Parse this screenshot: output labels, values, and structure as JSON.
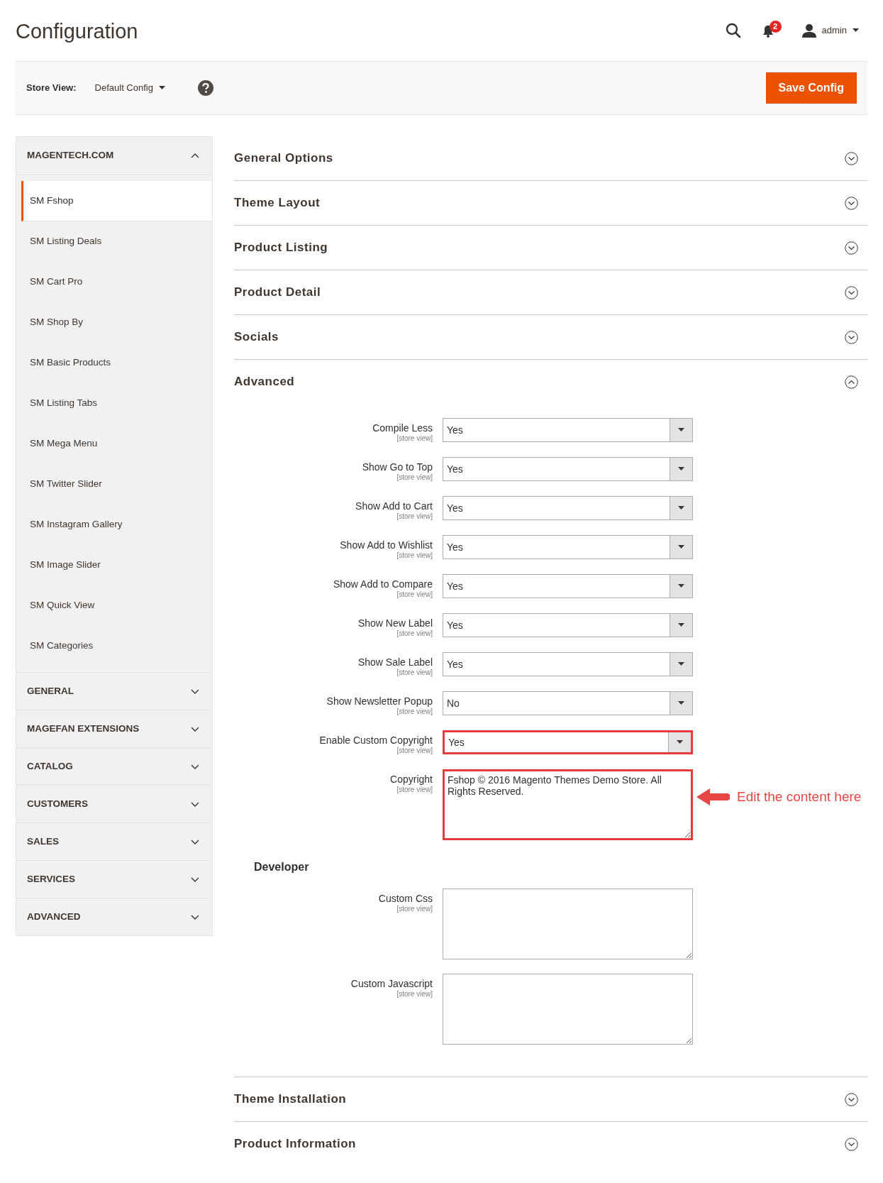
{
  "page_title": "Configuration",
  "header": {
    "notifications_count": "2",
    "user": "admin"
  },
  "store_bar": {
    "label": "Store View:",
    "value": "Default Config",
    "save_button": "Save Config"
  },
  "sidebar": [
    {
      "title": "MAGENTECH.COM",
      "expanded": true,
      "items": [
        {
          "label": "SM Fshop",
          "selected": true
        },
        {
          "label": "SM Listing Deals",
          "selected": false
        },
        {
          "label": "SM Cart Pro",
          "selected": false
        },
        {
          "label": "SM Shop By",
          "selected": false
        },
        {
          "label": "SM Basic Products",
          "selected": false
        },
        {
          "label": "SM Listing Tabs",
          "selected": false
        },
        {
          "label": "SM Mega Menu",
          "selected": false
        },
        {
          "label": "SM Twitter Slider",
          "selected": false
        },
        {
          "label": "SM Instagram Gallery",
          "selected": false
        },
        {
          "label": "SM Image Slider",
          "selected": false
        },
        {
          "label": "SM Quick View",
          "selected": false
        },
        {
          "label": "SM Categories",
          "selected": false
        }
      ]
    },
    {
      "title": "GENERAL",
      "expanded": false
    },
    {
      "title": "MAGEFAN EXTENSIONS",
      "expanded": false
    },
    {
      "title": "CATALOG",
      "expanded": false
    },
    {
      "title": "CUSTOMERS",
      "expanded": false
    },
    {
      "title": "SALES",
      "expanded": false
    },
    {
      "title": "SERVICES",
      "expanded": false
    },
    {
      "title": "ADVANCED",
      "expanded": false
    }
  ],
  "sections": [
    {
      "title": "General Options",
      "expanded": false
    },
    {
      "title": "Theme Layout",
      "expanded": false
    },
    {
      "title": "Product Listing",
      "expanded": false
    },
    {
      "title": "Product Detail",
      "expanded": false
    },
    {
      "title": "Socials",
      "expanded": false
    },
    {
      "title": "Advanced",
      "expanded": true,
      "groups": [
        {
          "fields": [
            {
              "label": "Compile Less",
              "scope": "[store view]",
              "kind": "select",
              "value": "Yes",
              "highlighted": false
            },
            {
              "label": "Show Go to Top",
              "scope": "[store view]",
              "kind": "select",
              "value": "Yes",
              "highlighted": false
            },
            {
              "label": "Show Add to Cart",
              "scope": "[store view]",
              "kind": "select",
              "value": "Yes",
              "highlighted": false
            },
            {
              "label": "Show Add to Wishlist",
              "scope": "[store view]",
              "kind": "select",
              "value": "Yes",
              "highlighted": false
            },
            {
              "label": "Show Add to Compare",
              "scope": "[store view]",
              "kind": "select",
              "value": "Yes",
              "highlighted": false
            },
            {
              "label": "Show New Label",
              "scope": "[store view]",
              "kind": "select",
              "value": "Yes",
              "highlighted": false
            },
            {
              "label": "Show Sale Label",
              "scope": "[store view]",
              "kind": "select",
              "value": "Yes",
              "highlighted": false
            },
            {
              "label": "Show Newsletter Popup",
              "scope": "[store view]",
              "kind": "select",
              "value": "No",
              "highlighted": false
            },
            {
              "label": "Enable Custom Copyright",
              "scope": "[store view]",
              "kind": "select",
              "value": "Yes",
              "highlighted": true
            },
            {
              "label": "Copyright",
              "scope": "[store view]",
              "kind": "textarea",
              "value": "Fshop © 2016 Magento Themes Demo Store. All Rights Reserved.",
              "highlighted": true,
              "annotation": "Edit the content here"
            }
          ]
        },
        {
          "title": "Developer",
          "fields": [
            {
              "label": "Custom Css",
              "scope": "[store view]",
              "kind": "textarea",
              "highlighted": false
            },
            {
              "label": "Custom Javascript",
              "scope": "[store view]",
              "kind": "textarea",
              "highlighted": false
            }
          ]
        }
      ]
    },
    {
      "title": "Theme Installation",
      "expanded": false
    },
    {
      "title": "Product Information",
      "expanded": false
    }
  ]
}
